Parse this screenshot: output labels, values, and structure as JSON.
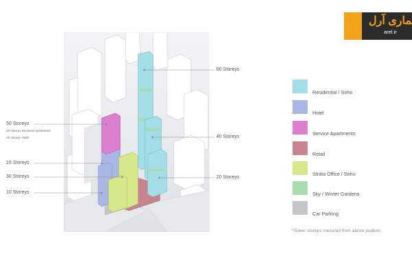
{
  "logo": {
    "text": "معماری آرل",
    "url_text": "arel.ir",
    "colors": {
      "orange": "#f5a21b",
      "dark": "#2c2c2c"
    }
  },
  "labels_left": {
    "storeys_50": "50 Storeys",
    "note_serviced": "25 storeys Serviced Apartments",
    "note_hotel": "25 storeys Hotel",
    "storeys_15": "15 Storeys",
    "storeys_30": "30 Storeys",
    "storeys_10": "10 Storeys"
  },
  "labels_right": {
    "storeys_80": "80 Storeys",
    "storeys_40": "40 Storeys",
    "storeys_20": "20 Storeys"
  },
  "legend": [
    {
      "label": "Residential / Soho",
      "color": "#a3dde6"
    },
    {
      "label": "Hotel",
      "color": "#a9b7e5"
    },
    {
      "label": "Service Apartments",
      "color": "#dd7fcf"
    },
    {
      "label": "Retail",
      "color": "#c88391"
    },
    {
      "label": "Strata Office / Soho",
      "color": "#d6e88a"
    },
    {
      "label": "Sky / Winter Gardens",
      "color": "#a7dcb0"
    },
    {
      "label": "Car Parking",
      "color": "#c3c6cb"
    }
  ],
  "footnote": "*Tower storeys mesured from above podium"
}
